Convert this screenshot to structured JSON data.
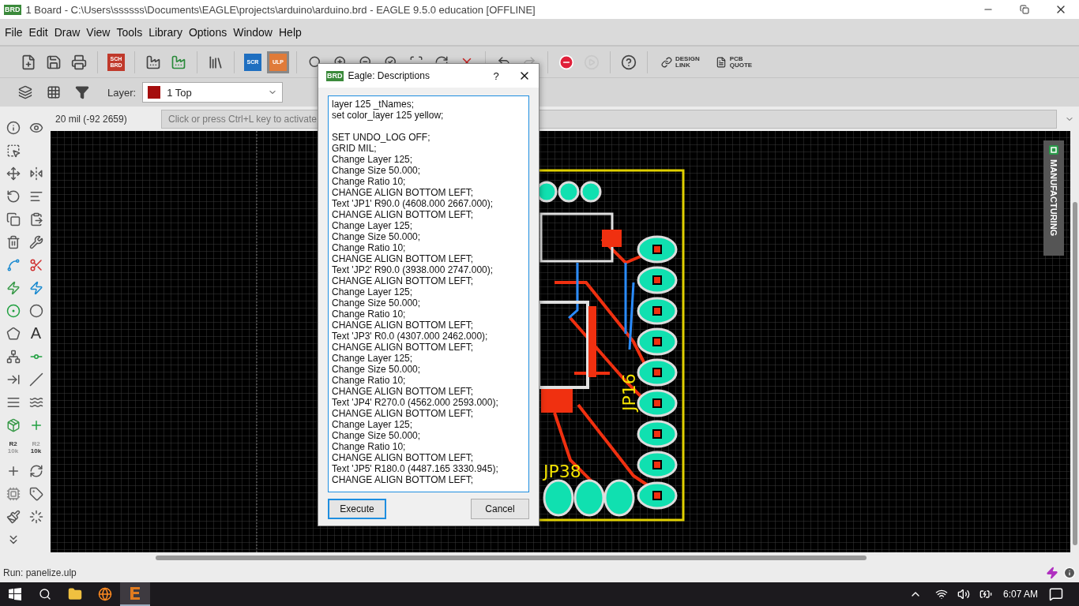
{
  "window": {
    "badge": "BRD",
    "title": "1 Board - C:\\Users\\ssssss\\Documents\\EAGLE\\projects\\arduino\\arduino.brd - EAGLE 9.5.0 education [OFFLINE]"
  },
  "menu": [
    "File",
    "Edit",
    "Draw",
    "View",
    "Tools",
    "Library",
    "Options",
    "Window",
    "Help"
  ],
  "toolbar": {
    "sch_brd": [
      "SCH",
      "BRD"
    ],
    "scr": "SCR",
    "ulp": "ULP",
    "design_link": [
      "DESIGN",
      "LINK"
    ],
    "pcb_quote": [
      "PCB",
      "QUOTE"
    ]
  },
  "layer_bar": {
    "label": "Layer:",
    "value": "1 Top",
    "color": "#a50d0d"
  },
  "command_line": {
    "coordinates": "20 mil (-92 2659)",
    "placeholder": "Click or press Ctrl+L key to activate"
  },
  "tools_panel": {
    "text_tool": "A",
    "name_tool": [
      "R2",
      "10k"
    ],
    "value_tool": [
      "R2",
      "10k"
    ]
  },
  "side_tab": {
    "label": "MANUFACTURING"
  },
  "board": {
    "labels": [
      "JP16",
      "JP38"
    ]
  },
  "dialog": {
    "badge": "BRD",
    "title": "Eagle: Descriptions",
    "help": "?",
    "script": "layer 125 _tNames;\nset color_layer 125 yellow;\n\nSET UNDO_LOG OFF;\nGRID MIL;\nChange Layer 125;\nChange Size 50.000;\nChange Ratio 10;\nCHANGE ALIGN BOTTOM LEFT;\nText 'JP1' R90.0 (4608.000 2667.000);\nCHANGE ALIGN BOTTOM LEFT;\nChange Layer 125;\nChange Size 50.000;\nChange Ratio 10;\nCHANGE ALIGN BOTTOM LEFT;\nText 'JP2' R90.0 (3938.000 2747.000);\nCHANGE ALIGN BOTTOM LEFT;\nChange Layer 125;\nChange Size 50.000;\nChange Ratio 10;\nCHANGE ALIGN BOTTOM LEFT;\nText 'JP3' R0.0 (4307.000 2462.000);\nCHANGE ALIGN BOTTOM LEFT;\nChange Layer 125;\nChange Size 50.000;\nChange Ratio 10;\nCHANGE ALIGN BOTTOM LEFT;\nText 'JP4' R270.0 (4562.000 2593.000);\nCHANGE ALIGN BOTTOM LEFT;\nChange Layer 125;\nChange Size 50.000;\nChange Ratio 10;\nCHANGE ALIGN BOTTOM LEFT;\nText 'JP5' R180.0 (4487.165 3330.945);\nCHANGE ALIGN BOTTOM LEFT;",
    "buttons": [
      "Execute",
      "Cancel"
    ]
  },
  "status_bar": {
    "text": "Run: panelize.ulp"
  },
  "taskbar": {
    "time": "6:07 AM"
  }
}
